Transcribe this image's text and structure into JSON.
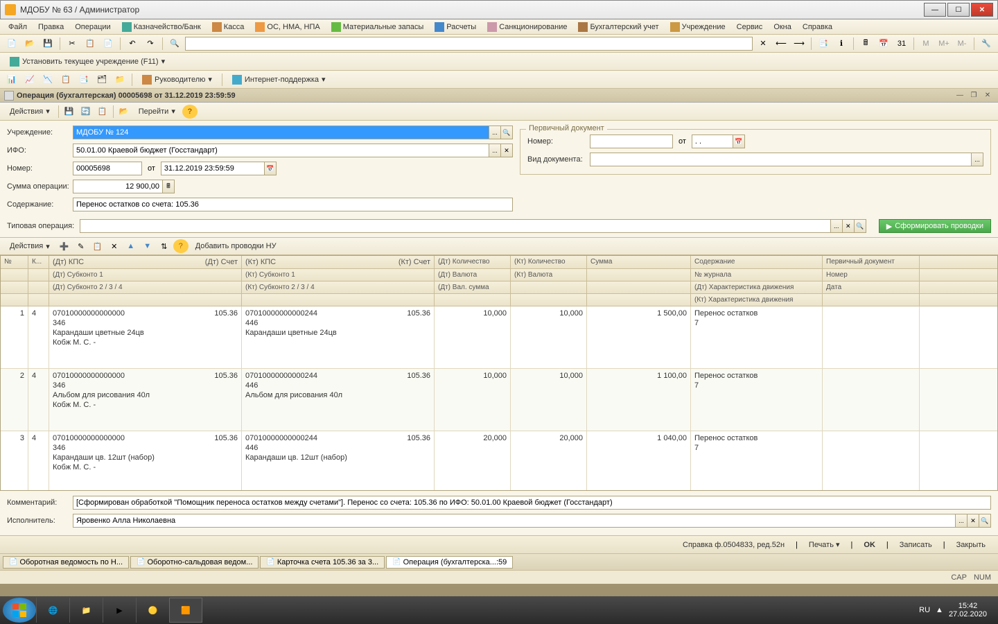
{
  "titlebar": {
    "text": "МДОБУ № 63  / Администратор"
  },
  "menubar": [
    "Файл",
    "Правка",
    "Операции",
    "Казначейство/Банк",
    "Касса",
    "ОС, НМА, НПА",
    "Материальные запасы",
    "Расчеты",
    "Санкционирование",
    "Бухгалтерский учет",
    "Учреждение",
    "Сервис",
    "Окна",
    "Справка"
  ],
  "toolbar2": {
    "set_institution": "Установить текущее учреждение (F11)"
  },
  "toolbar3": {
    "manager": "Руководителю",
    "support": "Интернет-поддержка"
  },
  "doc": {
    "title": "Операция (бухгалтерская) 00005698 от 31.12.2019 23:59:59",
    "actions": "Действия",
    "goto": "Перейти"
  },
  "form": {
    "institution_label": "Учреждение:",
    "institution_value": "МДОБУ № 124",
    "ifo_label": "ИФО:",
    "ifo_value": "50.01.00 Краевой бюджет (Госстандарт)",
    "number_label": "Номер:",
    "number_value": "00005698",
    "from_label": "от",
    "date_value": "31.12.2019 23:59:59",
    "sum_label": "Сумма операции:",
    "sum_value": "12 900,00",
    "content_label": "Содержание:",
    "content_value": "Перенос остатков со счета: 105.36",
    "typical_label": "Типовая операция:",
    "typical_value": "",
    "primary_legend": "Первичный документ",
    "prim_number_label": "Номер:",
    "prim_from": "от",
    "prim_date": ". .",
    "prim_type_label": "Вид документа:",
    "generate": "Сформировать проводки"
  },
  "table_toolbar": {
    "actions": "Действия",
    "add_nu": "Добавить проводки НУ"
  },
  "grid_headers": {
    "row1": {
      "n": "№",
      "k": "К...",
      "dt_kps": "(Дт) КПС",
      "dt_schet": "(Дт) Счет",
      "kt_kps": "(Кт) КПС",
      "kt_schet": "(Кт) Счет",
      "dt_qty": "(Дт) Количество",
      "kt_qty": "(Кт) Количество",
      "sum": "Сумма",
      "content": "Содержание",
      "doc": "Первичный документ"
    },
    "row2": {
      "dt_sub1": "(Дт) Субконто 1",
      "kt_sub1": "(Кт) Субконто 1",
      "dt_cur": "(Дт) Валюта",
      "kt_cur": "(Кт) Валюта",
      "journal": "№ журнала",
      "doc_num": "Номер"
    },
    "row3": {
      "dt_sub234": "(Дт) Субконто 2 / 3 / 4",
      "kt_sub234": "(Кт) Субконто 2 / 3 / 4",
      "dt_val": "(Дт) Вал. сумма",
      "dt_char": "(Дт) Характеристика движения",
      "date": "Дата"
    },
    "row4": {
      "kt_char": "(Кт) Характеристика движения"
    }
  },
  "rows": [
    {
      "n": "1",
      "k": "4",
      "dt_kps": "07010000000000000",
      "dt_schet": "105.36",
      "dt_sub1": "346",
      "dt_sub2": "Карандаши цветные  24цв",
      "dt_sub3": "Кобж М. С. -",
      "kt_kps": "07010000000000244",
      "kt_schet": "105.36",
      "kt_sub1": "446",
      "kt_sub2": "Карандаши цветные  24цв",
      "dt_qty": "10,000",
      "kt_qty": "10,000",
      "sum": "1 500,00",
      "content": "Перенос остатков",
      "journal": "7"
    },
    {
      "n": "2",
      "k": "4",
      "dt_kps": "07010000000000000",
      "dt_schet": "105.36",
      "dt_sub1": "346",
      "dt_sub2": "Альбом для рисования 40л",
      "dt_sub3": "Кобж М. С. -",
      "kt_kps": "07010000000000244",
      "kt_schet": "105.36",
      "kt_sub1": "446",
      "kt_sub2": "Альбом для рисования 40л",
      "dt_qty": "10,000",
      "kt_qty": "10,000",
      "sum": "1 100,00",
      "content": "Перенос остатков",
      "journal": "7"
    },
    {
      "n": "3",
      "k": "4",
      "dt_kps": "07010000000000000",
      "dt_schet": "105.36",
      "dt_sub1": "346",
      "dt_sub2": "Карандаши цв. 12шт (набор)",
      "dt_sub3": "Кобж М. С. -",
      "kt_kps": "07010000000000244",
      "kt_schet": "105.36",
      "kt_sub1": "446",
      "kt_sub2": "Карандаши цв. 12шт (набор)",
      "dt_qty": "20,000",
      "kt_qty": "20,000",
      "sum": "1 040,00",
      "content": "Перенос остатков",
      "journal": "7"
    }
  ],
  "footer": {
    "comment_label": "Комментарий:",
    "comment_value": "[Сформирован обработкой \"Помощник переноса остатков между счетами\"]. Перенос со счета: 105.36 по ИФО: 50.01.00 Краевой бюджет (Госстандарт)",
    "executor_label": "Исполнитель:",
    "executor_value": "Яровенко Алла Николаевна"
  },
  "bottom": {
    "ref": "Справка ф.0504833, ред.52н",
    "print": "Печать",
    "ok": "OK",
    "save": "Записать",
    "close": "Закрыть"
  },
  "tabs": [
    "Оборотная ведомость по Н...",
    "Оборотно-сальдовая ведом...",
    "Карточка счета 105.36 за 3...",
    "Операция (бухгалтерска...:59"
  ],
  "status": {
    "cap": "CAP",
    "num": "NUM"
  },
  "tray": {
    "lang": "RU",
    "time": "15:42",
    "date": "27.02.2020"
  }
}
